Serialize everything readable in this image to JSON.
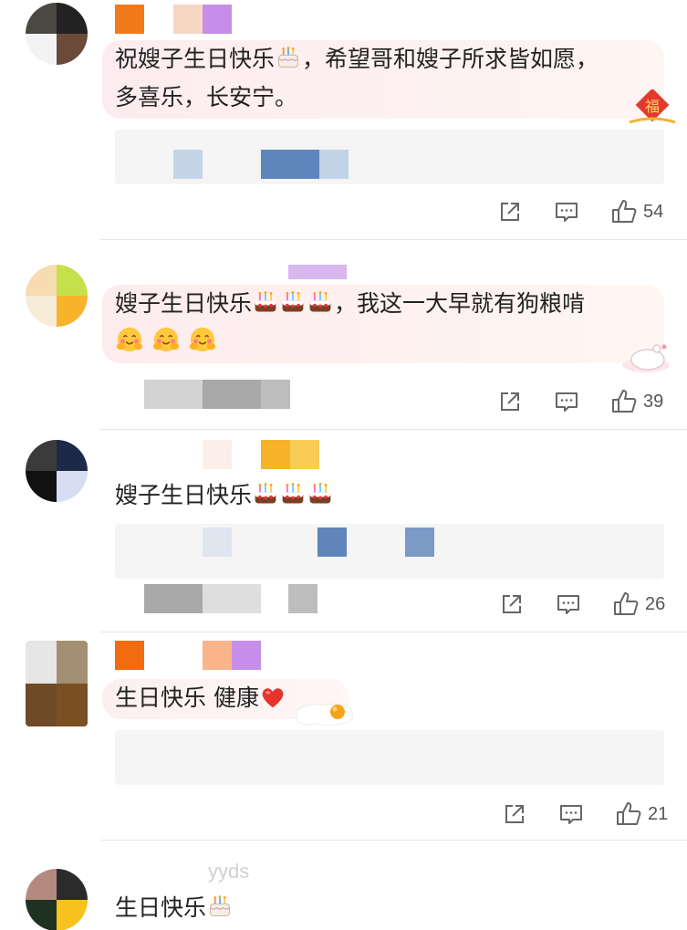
{
  "comments": [
    {
      "text": "祝嫂子生日快乐",
      "text_after_emoji": "，希望哥和嫂子所求皆如愿，\n多喜乐，长安宁。",
      "emoji": [
        "cake-icon"
      ],
      "likes": "54"
    },
    {
      "text": "嫂子生日快乐",
      "text_after_emoji": "，我这一大早就有狗粮啃",
      "emoji": [
        "cake-icon",
        "cake-icon",
        "cake-icon",
        "hug-face-icon",
        "hug-face-icon",
        "hug-face-icon"
      ],
      "likes": "39"
    },
    {
      "text": "嫂子生日快乐",
      "emoji": [
        "cake-icon",
        "cake-icon",
        "cake-icon"
      ],
      "likes": "26"
    },
    {
      "text": "生日快乐 健康",
      "emoji": [
        "red-heart-icon"
      ],
      "likes": "21"
    },
    {
      "username_fragment": "yyds",
      "text": "生日快乐",
      "emoji": [
        "cake-icon"
      ]
    }
  ],
  "colors": {
    "like_text": "#555555",
    "bubble_pink": "#fdeff0",
    "bubble_cream": "#fff3ec",
    "bubble_plain": "#fff4f4",
    "reply_bg": "#f5f5f5"
  }
}
